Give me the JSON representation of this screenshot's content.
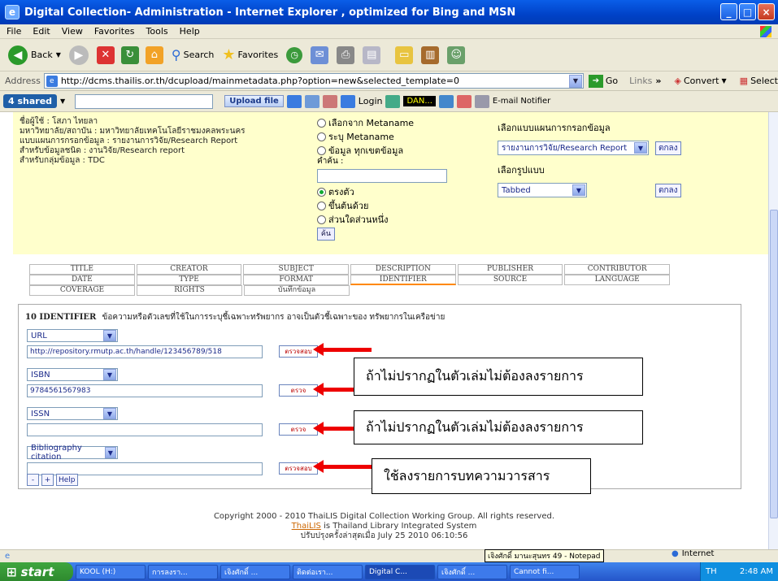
{
  "window": {
    "title": "Digital Collection- Administration - Internet Explorer , optimized for Bing and MSN"
  },
  "menu": [
    "File",
    "Edit",
    "View",
    "Favorites",
    "Tools",
    "Help"
  ],
  "toolbar": {
    "back": "Back",
    "search": "Search",
    "favorites": "Favorites"
  },
  "address": {
    "label": "Address",
    "url": "http://dcms.thailis.or.th/dcupload/mainmetadata.php?option=new&selected_template=0",
    "go": "Go",
    "links": "Links",
    "convert": "Convert",
    "select": "Select"
  },
  "shared_bar": {
    "logo": "4 shared",
    "upload": "Upload file",
    "login": "Login",
    "dan": "DAN...",
    "email_notifier": "E-mail Notifier"
  },
  "info": {
    "lines": [
      "ชื่อผู้ใช้ : โสภา ไทยลา",
      "มหาวิทยาลัย/สถาบัน : มหาวิทยาลัยเทคโนโลยีราชมงคลพระนคร",
      "แบบแผนการกรอกข้อมูล : รายงานการวิจัย/Research Report",
      "สำหรับข้อมูลชนิด : งานวิจัย/Research report",
      "สำหรับกลุ่มข้อมูล : TDC"
    ]
  },
  "search": {
    "options": [
      "เลือกจาก Metaname",
      "ระบุ Metaname",
      "ข้อมูล ทุกเขตข้อมูล"
    ],
    "keyword_label": "คำค้น :",
    "match_options": [
      "ตรงตัว",
      "ขึ้นต้นด้วย",
      "ส่วนใดส่วนหนึ่ง"
    ],
    "match_selected": 0,
    "find_button": "ค้น"
  },
  "template_panel": {
    "template_label": "เลือกแบบแผนการกรอกข้อมูล",
    "template_value": "รายงานการวิจัย/Research Report",
    "ok1": "ตกลง",
    "format_label": "เลือกรูปแบบ",
    "format_value": "Tabbed",
    "ok2": "ตกลง"
  },
  "tabs": {
    "row1": [
      "TITLE",
      "CREATOR",
      "SUBJECT",
      "DESCRIPTION",
      "PUBLISHER",
      "CONTRIBUTOR"
    ],
    "row2": [
      "DATE",
      "TYPE",
      "FORMAT",
      "IDENTIFIER",
      "SOURCE",
      "LANGUAGE"
    ],
    "row3": [
      "COVERAGE",
      "RIGHTS",
      "บันทึกข้อมูล"
    ],
    "active": "IDENTIFIER"
  },
  "section": {
    "number_title": "10 IDENTIFIER",
    "description": "ข้อความหรือตัวเลขที่ใช้ในการระบุชี้เฉพาะทรัพยากร อาจเป็นตัวชี้เฉพาะของ ทรัพยากรในเครือข่าย"
  },
  "fields": [
    {
      "type": "URL",
      "value": "http://repository.rmutp.ac.th/handle/123456789/518",
      "check": "ตรวจสอบ"
    },
    {
      "type": "ISBN",
      "value": "9784561567983",
      "check": "ตรวจ"
    },
    {
      "type": "ISSN",
      "value": "",
      "check": "ตรวจ"
    },
    {
      "type": "Bibliography citation",
      "value": "",
      "check": "ตรวจสอบ"
    }
  ],
  "notes": [
    "ถ้าไม่ปรากฏในตัวเล่มไม่ต้องลงรายการ",
    "ถ้าไม่ปรากฏในตัวเล่มไม่ต้องลงรายการ",
    "ใช้ลงรายการบทความวารสาร"
  ],
  "small_buttons": [
    "-",
    "+",
    "Help"
  ],
  "footer": {
    "copyright": "Copyright 2000 - 2010 ThaiLIS Digital Collection Working Group. All rights reserved.",
    "thailis_link": "ThaiLIS",
    "thailis_rest": " is Thailand Library Integrated System",
    "updated": "ปรับปรุงครั้งล่าสุดเมื่อ July 25 2010 06:10:56"
  },
  "status": {
    "tooltip": "เจิงศักดิ์ มานะสุนทร 49 - Notepad",
    "zone": "Internet"
  },
  "taskbar": {
    "start": "start",
    "tasks": [
      "KOOL (H:)",
      "การลงรา...",
      "เจิงศักดิ์ ...",
      "ติดต่อเรา...",
      "Digital C...",
      "เจิงศักดิ์ ...",
      "Cannot fi..."
    ],
    "lang": "TH",
    "clock": "2:48 AM"
  }
}
